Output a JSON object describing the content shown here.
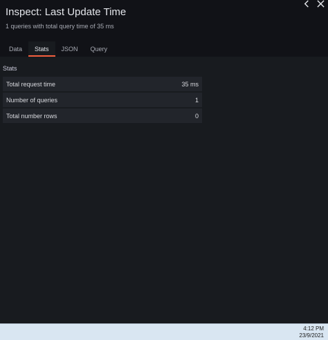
{
  "drawer": {
    "title": "Inspect: Last Update Time",
    "subtitle": "1 queries with total query time of 35 ms",
    "icons": {
      "expand": "chevron-left-icon",
      "close": "close-icon"
    }
  },
  "tabs": [
    {
      "label": "Data",
      "active": false
    },
    {
      "label": "Stats",
      "active": true
    },
    {
      "label": "JSON",
      "active": false
    },
    {
      "label": "Query",
      "active": false
    }
  ],
  "stats": {
    "section_title": "Stats",
    "rows": [
      {
        "label": "Total request time",
        "value": "35 ms"
      },
      {
        "label": "Number of queries",
        "value": "1"
      },
      {
        "label": "Total number rows",
        "value": "0"
      }
    ]
  },
  "taskbar": {
    "time": "4:12 PM",
    "date": "23/9/2021"
  },
  "colors": {
    "background": "#181b1f",
    "header": "#111217",
    "row": "#22252b",
    "accent": "#f55f3e",
    "taskbar": "#d9e6f2"
  }
}
